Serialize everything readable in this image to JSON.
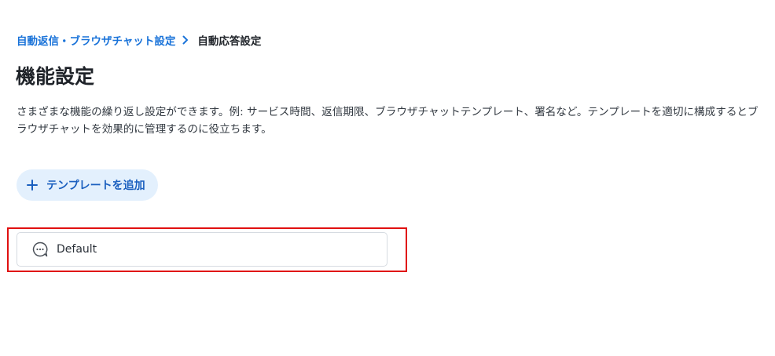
{
  "breadcrumb": {
    "parent": "自動返信・ブラウザチャット設定",
    "current": "自動応答設定"
  },
  "page": {
    "title": "機能設定",
    "description": "さまざまな機能の繰り返し設定ができます。例: サービス時間、返信期限、ブラウザチャットテンプレート、署名など。テンプレートを適切に構成するとブラウザチャットを効果的に管理するのに役立ちます。"
  },
  "actions": {
    "add_template_label": "テンプレートを追加"
  },
  "templates": [
    {
      "name": "Default",
      "icon": "chat-bubble-icon"
    }
  ],
  "colors": {
    "link": "#1a73d9",
    "button_bg": "#e3f0fd",
    "button_text": "#1a5fbf",
    "highlight": "#e01010"
  }
}
